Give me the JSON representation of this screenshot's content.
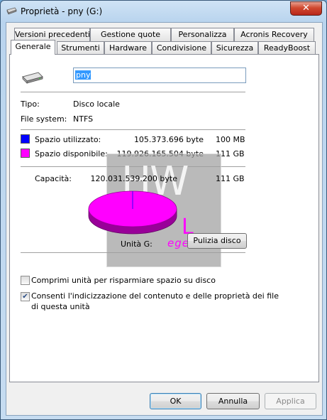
{
  "window": {
    "title": "Proprietà - pny (G:)",
    "close_label": "✕"
  },
  "tabs_row1": [
    "Versioni precedenti",
    "Gestione quote",
    "Personalizza",
    "Acronis Recovery"
  ],
  "tabs_row2": [
    "Generale",
    "Strumenti",
    "Hardware",
    "Condivisione",
    "Sicurezza",
    "ReadyBoost"
  ],
  "general": {
    "drive_name": "pny",
    "type_label": "Tipo:",
    "type_value": "Disco locale",
    "fs_label": "File system:",
    "fs_value": "NTFS",
    "used_label": "Spazio utilizzato:",
    "used_bytes": "105.373.696 byte",
    "used_short": "100 MB",
    "free_label": "Spazio disponibile:",
    "free_bytes": "119.926.165.504 byte",
    "free_short": "111 GB",
    "capacity_label": "Capacità:",
    "capacity_bytes": "120.031.539.200 byte",
    "capacity_short": "111 GB",
    "drive_label": "Unità G:",
    "cleanup_button": "Pulizia disco",
    "compress_label": "Comprimi unità per risparmiare spazio su disco",
    "compress_checked": false,
    "index_label_line1": "Consenti l'indicizzazione del contenuto e delle proprietà dei file",
    "index_label_line2": "di questa unità",
    "index_checked": true,
    "used_fraction": 0.0009
  },
  "colors": {
    "used": "#0000ff",
    "free": "#ff00ff"
  },
  "watermark": {
    "logo": "HW",
    "brand": "Legend"
  },
  "buttons": {
    "ok": "OK",
    "cancel": "Annulla",
    "apply": "Applica"
  }
}
